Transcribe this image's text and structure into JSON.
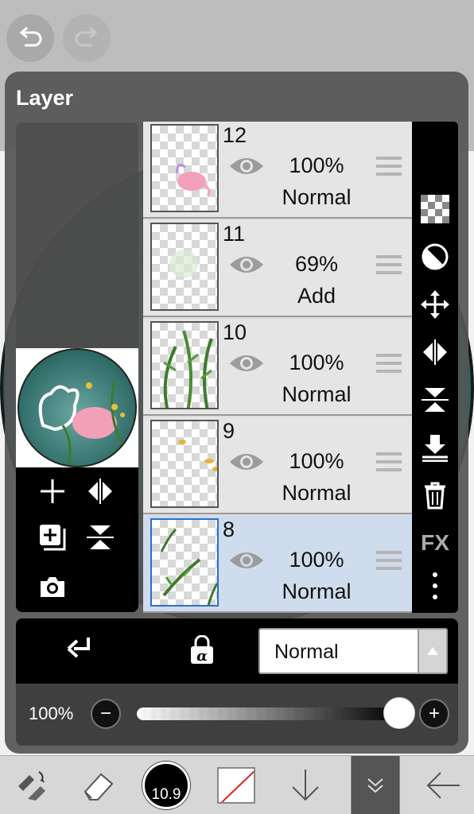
{
  "panel": {
    "title": "Layer"
  },
  "layers": [
    {
      "number": "12",
      "opacity": "100%",
      "blend": "Normal",
      "visible": true,
      "selected": false
    },
    {
      "number": "11",
      "opacity": "69%",
      "blend": "Add",
      "visible": true,
      "selected": false
    },
    {
      "number": "10",
      "opacity": "100%",
      "blend": "Normal",
      "visible": true,
      "selected": false
    },
    {
      "number": "9",
      "opacity": "100%",
      "blend": "Normal",
      "visible": true,
      "selected": false
    },
    {
      "number": "8",
      "opacity": "100%",
      "blend": "Normal",
      "visible": true,
      "selected": true
    }
  ],
  "right_tools": {
    "fx_label": "FX"
  },
  "blend_mode": {
    "selected": "Normal"
  },
  "opacity": {
    "label": "100%",
    "value": 1.0
  },
  "brush": {
    "size_label": "10.9"
  },
  "icons": {
    "undo": "undo-icon",
    "redo": "redo-icon",
    "add_layer": "plus-icon",
    "flip_h": "flip-horizontal-icon",
    "duplicate": "duplicate-layer-icon",
    "flip_v": "flip-vertical-icon",
    "camera": "camera-icon",
    "transparency": "checkerboard-icon",
    "invert": "half-circle-icon",
    "move": "move-arrows-icon",
    "merge_down": "merge-down-icon",
    "delete": "trash-icon",
    "more": "vertical-dots-icon",
    "clip": "clip-arrow-icon",
    "alpha_lock": "alpha-lock-icon"
  },
  "colors": {
    "selected_layer": "#cfdced",
    "accent_blue": "#2a6fd1",
    "panel_bg": "#555555"
  }
}
